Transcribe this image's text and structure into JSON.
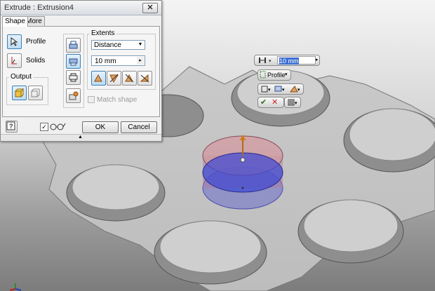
{
  "dialog": {
    "title": "Extrude : Extrusion4",
    "close_label": "✕",
    "tabs": [
      "Shape",
      "More"
    ],
    "profile_label": "Profile",
    "solids_label": "Solids",
    "output_label": "Output",
    "extents_label": "Extents",
    "extents_type": "Distance",
    "distance_value": "10 mm",
    "match_shape_label": "Match shape",
    "ok_label": "OK",
    "cancel_label": "Cancel"
  },
  "mini_toolbar": {
    "distance_value": "10 mm",
    "profile_label": "Profile"
  },
  "colors": {
    "accent_blue": "#3d7fb5",
    "cancel_red": "#d02020",
    "ok_check": "#2b6e1e",
    "preview_red": "#c8747a",
    "preview_blue": "#3a47d6",
    "part_face": "#cfcfcf"
  },
  "icons": [
    "profile-select-icon",
    "solids-icon",
    "output-solid-icon",
    "output-surface-icon",
    "direction-icon",
    "extent-distance-icon",
    "preview-icon",
    "help-icon",
    "glasses-icon",
    "check-icon",
    "cancel-icon"
  ]
}
